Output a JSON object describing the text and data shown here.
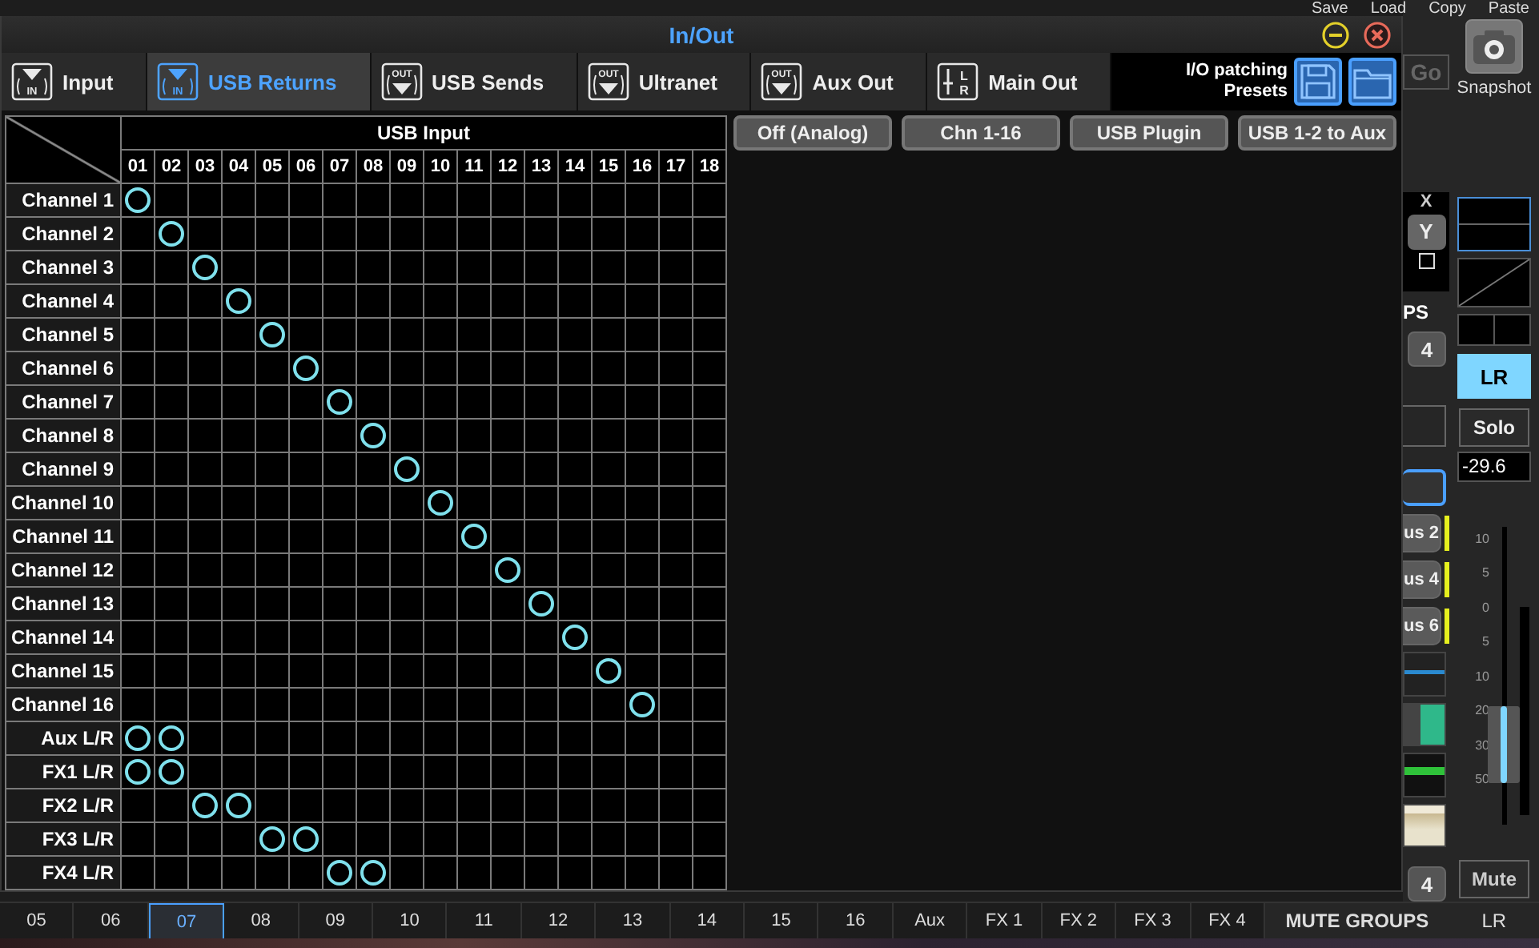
{
  "window": {
    "title": "In/Out"
  },
  "tabs": [
    {
      "label": "Input",
      "kind": "in",
      "icon_text": [
        "IN"
      ],
      "selected": false
    },
    {
      "label": "USB Returns",
      "kind": "in",
      "icon_text": [
        "IN"
      ],
      "selected": true
    },
    {
      "label": "USB Sends",
      "kind": "out",
      "icon_text": [
        "OUT"
      ],
      "selected": false
    },
    {
      "label": "Ultranet",
      "kind": "out",
      "icon_text": [
        "OUT"
      ],
      "selected": false
    },
    {
      "label": "Aux Out",
      "kind": "out",
      "icon_text": [
        "OUT"
      ],
      "selected": false
    },
    {
      "label": "Main Out",
      "kind": "lr",
      "icon_text": [
        "L",
        "R"
      ],
      "selected": false
    }
  ],
  "presets": {
    "label": "I/O patching Presets"
  },
  "grid": {
    "group_header": "USB Input",
    "columns": [
      "01",
      "02",
      "03",
      "04",
      "05",
      "06",
      "07",
      "08",
      "09",
      "10",
      "11",
      "12",
      "13",
      "14",
      "15",
      "16",
      "17",
      "18"
    ],
    "rows": [
      {
        "label": "Channel 1",
        "patched": [
          true,
          false,
          false,
          false,
          false,
          false,
          false,
          false,
          false,
          false,
          false,
          false,
          false,
          false,
          false,
          false,
          false,
          false
        ]
      },
      {
        "label": "Channel 2",
        "patched": [
          false,
          true,
          false,
          false,
          false,
          false,
          false,
          false,
          false,
          false,
          false,
          false,
          false,
          false,
          false,
          false,
          false,
          false
        ]
      },
      {
        "label": "Channel 3",
        "patched": [
          false,
          false,
          true,
          false,
          false,
          false,
          false,
          false,
          false,
          false,
          false,
          false,
          false,
          false,
          false,
          false,
          false,
          false
        ]
      },
      {
        "label": "Channel 4",
        "patched": [
          false,
          false,
          false,
          true,
          false,
          false,
          false,
          false,
          false,
          false,
          false,
          false,
          false,
          false,
          false,
          false,
          false,
          false
        ]
      },
      {
        "label": "Channel 5",
        "patched": [
          false,
          false,
          false,
          false,
          true,
          false,
          false,
          false,
          false,
          false,
          false,
          false,
          false,
          false,
          false,
          false,
          false,
          false
        ]
      },
      {
        "label": "Channel 6",
        "patched": [
          false,
          false,
          false,
          false,
          false,
          true,
          false,
          false,
          false,
          false,
          false,
          false,
          false,
          false,
          false,
          false,
          false,
          false
        ]
      },
      {
        "label": "Channel 7",
        "patched": [
          false,
          false,
          false,
          false,
          false,
          false,
          true,
          false,
          false,
          false,
          false,
          false,
          false,
          false,
          false,
          false,
          false,
          false
        ]
      },
      {
        "label": "Channel 8",
        "patched": [
          false,
          false,
          false,
          false,
          false,
          false,
          false,
          true,
          false,
          false,
          false,
          false,
          false,
          false,
          false,
          false,
          false,
          false
        ]
      },
      {
        "label": "Channel 9",
        "patched": [
          false,
          false,
          false,
          false,
          false,
          false,
          false,
          false,
          true,
          false,
          false,
          false,
          false,
          false,
          false,
          false,
          false,
          false
        ]
      },
      {
        "label": "Channel 10",
        "patched": [
          false,
          false,
          false,
          false,
          false,
          false,
          false,
          false,
          false,
          true,
          false,
          false,
          false,
          false,
          false,
          false,
          false,
          false
        ]
      },
      {
        "label": "Channel 11",
        "patched": [
          false,
          false,
          false,
          false,
          false,
          false,
          false,
          false,
          false,
          false,
          true,
          false,
          false,
          false,
          false,
          false,
          false,
          false
        ]
      },
      {
        "label": "Channel 12",
        "patched": [
          false,
          false,
          false,
          false,
          false,
          false,
          false,
          false,
          false,
          false,
          false,
          true,
          false,
          false,
          false,
          false,
          false,
          false
        ]
      },
      {
        "label": "Channel 13",
        "patched": [
          false,
          false,
          false,
          false,
          false,
          false,
          false,
          false,
          false,
          false,
          false,
          false,
          true,
          false,
          false,
          false,
          false,
          false
        ]
      },
      {
        "label": "Channel 14",
        "patched": [
          false,
          false,
          false,
          false,
          false,
          false,
          false,
          false,
          false,
          false,
          false,
          false,
          false,
          true,
          false,
          false,
          false,
          false
        ]
      },
      {
        "label": "Channel 15",
        "patched": [
          false,
          false,
          false,
          false,
          false,
          false,
          false,
          false,
          false,
          false,
          false,
          false,
          false,
          false,
          true,
          false,
          false,
          false
        ]
      },
      {
        "label": "Channel 16",
        "patched": [
          false,
          false,
          false,
          false,
          false,
          false,
          false,
          false,
          false,
          false,
          false,
          false,
          false,
          false,
          false,
          true,
          false,
          false
        ]
      },
      {
        "label": "Aux L/R",
        "patched": [
          true,
          true,
          false,
          false,
          false,
          false,
          false,
          false,
          false,
          false,
          false,
          false,
          false,
          false,
          false,
          false,
          false,
          false
        ]
      },
      {
        "label": "FX1 L/R",
        "patched": [
          true,
          true,
          false,
          false,
          false,
          false,
          false,
          false,
          false,
          false,
          false,
          false,
          false,
          false,
          false,
          false,
          false,
          false
        ]
      },
      {
        "label": "FX2 L/R",
        "patched": [
          false,
          false,
          true,
          true,
          false,
          false,
          false,
          false,
          false,
          false,
          false,
          false,
          false,
          false,
          false,
          false,
          false,
          false
        ]
      },
      {
        "label": "FX3 L/R",
        "patched": [
          false,
          false,
          false,
          false,
          true,
          true,
          false,
          false,
          false,
          false,
          false,
          false,
          false,
          false,
          false,
          false,
          false,
          false
        ]
      },
      {
        "label": "FX4 L/R",
        "patched": [
          false,
          false,
          false,
          false,
          false,
          false,
          true,
          true,
          false,
          false,
          false,
          false,
          false,
          false,
          false,
          false,
          false,
          false
        ]
      }
    ]
  },
  "preset_buttons": [
    "Off (Analog)",
    "Chn 1-16",
    "USB Plugin",
    "USB 1-2 to Aux"
  ],
  "mixer": {
    "top_labels": [
      "Save",
      "Load",
      "Copy",
      "Paste"
    ],
    "go_button": "Go",
    "snapshot_label": "Snapshot",
    "x_label": "X",
    "y_button": "Y",
    "checkbox": {
      "checked": false
    },
    "ps_label": "PS",
    "group_button": "4",
    "bus_buttons": [
      "us 2",
      "us 4",
      "us 6"
    ],
    "bottom_group_button": "4",
    "lr_button": {
      "label": "LR",
      "selected": true
    },
    "solo_button": "Solo",
    "fader_reading": "-29.6",
    "scale": [
      "10",
      "5",
      "0",
      "5",
      "10",
      "20",
      "30",
      "50"
    ],
    "fader": {
      "level": 0.27
    },
    "mute_button": "Mute"
  },
  "bottom_bar": {
    "tabs": [
      {
        "label": "05",
        "selected": false
      },
      {
        "label": "06",
        "selected": false
      },
      {
        "label": "07",
        "selected": true
      },
      {
        "label": "08",
        "selected": false
      },
      {
        "label": "09",
        "selected": false
      },
      {
        "label": "10",
        "selected": false
      },
      {
        "label": "11",
        "selected": false
      },
      {
        "label": "12",
        "selected": false
      },
      {
        "label": "13",
        "selected": false
      },
      {
        "label": "14",
        "selected": false
      },
      {
        "label": "15",
        "selected": false
      },
      {
        "label": "16",
        "selected": false
      },
      {
        "label": "Aux",
        "selected": false
      },
      {
        "label": "FX 1",
        "selected": false
      },
      {
        "label": "FX 2",
        "selected": false
      },
      {
        "label": "FX 3",
        "selected": false
      },
      {
        "label": "FX 4",
        "selected": false
      }
    ],
    "mute_groups": "MUTE GROUPS",
    "strip_label": "LR"
  }
}
